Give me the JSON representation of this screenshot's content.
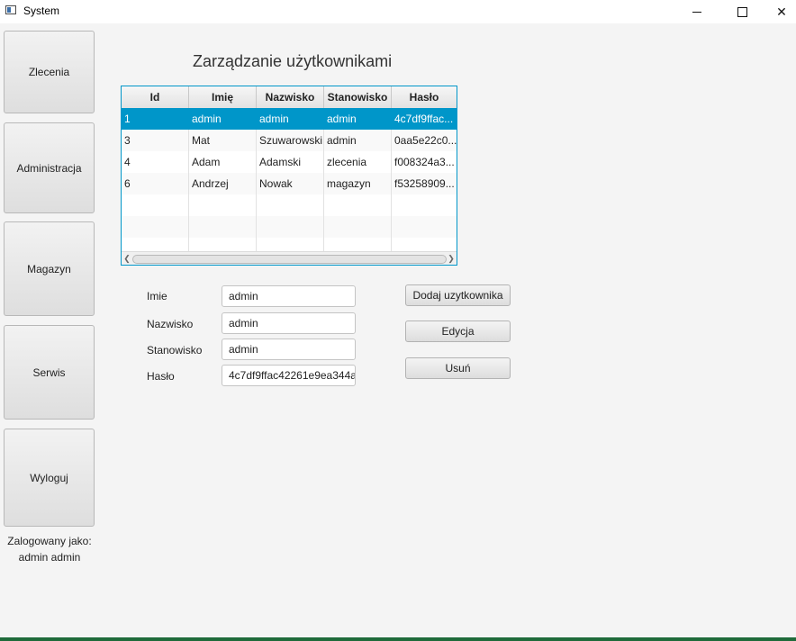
{
  "window": {
    "title": "System",
    "minimize": "—",
    "maximize": "☐",
    "close": "✕"
  },
  "sidebar": {
    "items": [
      {
        "label": "Zlecenia"
      },
      {
        "label": "Administracja"
      },
      {
        "label": "Magazyn"
      },
      {
        "label": "Serwis"
      },
      {
        "label": "Wyloguj"
      }
    ],
    "logged_line1": "Zalogowany jako:",
    "logged_line2": "admin admin"
  },
  "main": {
    "heading": "Zarządzanie użytkownikami",
    "table": {
      "columns": [
        "Id",
        "Imię",
        "Nazwisko",
        "Stanowisko",
        "Hasło"
      ],
      "rows": [
        [
          "1",
          "admin",
          "admin",
          "admin",
          "4c7df9ffac..."
        ],
        [
          "3",
          "Mat",
          "Szuwarowski",
          "admin",
          "0aa5e22c0..."
        ],
        [
          "4",
          "Adam",
          "Adamski",
          "zlecenia",
          "f008324a3..."
        ],
        [
          "6",
          "Andrzej",
          "Nowak",
          "magazyn",
          "f53258909..."
        ]
      ],
      "selected_row": 0
    },
    "form": {
      "imie_label": "Imie",
      "imie_value": "admin",
      "nazwisko_label": "Nazwisko",
      "nazwisko_value": "admin",
      "stanowisko_label": "Stanowisko",
      "stanowisko_value": "admin",
      "haslo_label": "Hasło",
      "haslo_value": "4c7df9ffac42261e9ea344a"
    },
    "actions": {
      "add": "Dodaj uzytkownika",
      "edit": "Edycja",
      "delete": "Usuń"
    }
  }
}
